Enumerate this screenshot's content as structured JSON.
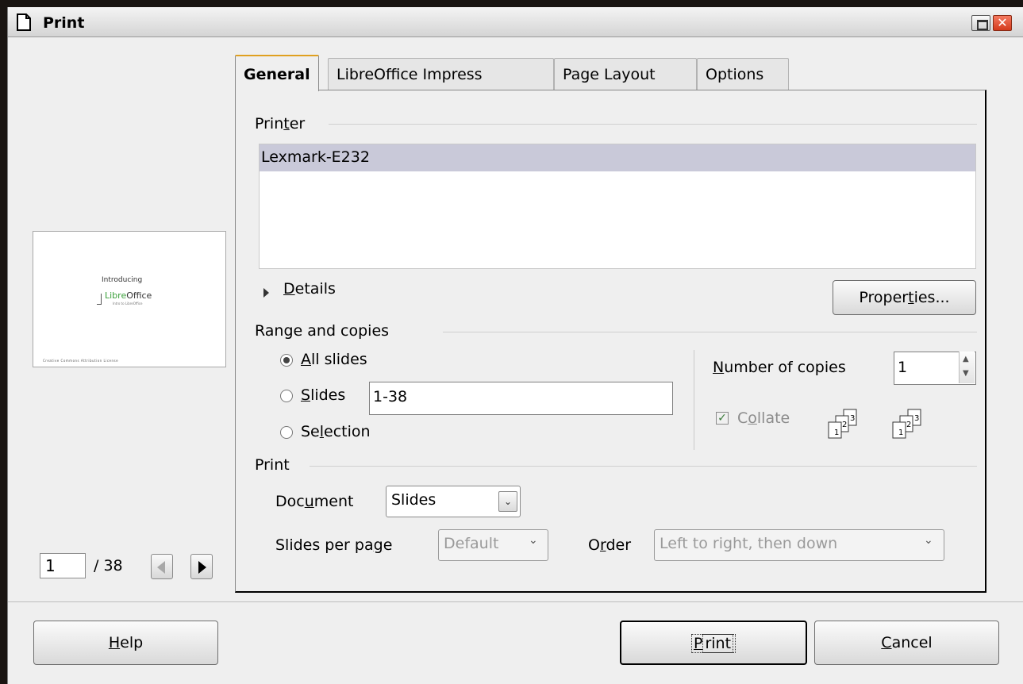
{
  "window": {
    "title": "Print",
    "close_glyph": "✕"
  },
  "preview": {
    "intro": "Introducing",
    "logo_plain": "Libre",
    "logo_rest": "Office",
    "subtitle": "Intro to LibreOffice",
    "footer": "Creative Commons Attribution License"
  },
  "pager": {
    "current": "1",
    "total": "/ 38"
  },
  "tabs": [
    {
      "label": "General"
    },
    {
      "label": "LibreOffice Impress"
    },
    {
      "label": "Page Layout"
    },
    {
      "label": "Options"
    }
  ],
  "printer": {
    "section_pre": "Prin",
    "section_mn": "t",
    "section_post": "er",
    "selected": "Lexmark-E232",
    "details_mn": "D",
    "details_rest": "etails",
    "properties_pre": "Proper",
    "properties_mn": "t",
    "properties_post": "ies..."
  },
  "range": {
    "section": "Range and copies",
    "all_mn": "A",
    "all_rest": "ll slides",
    "slides_mn": "S",
    "slides_rest": "lides",
    "slides_value": "1-38",
    "selection_pre": "Se",
    "selection_mn": "l",
    "selection_post": "ection",
    "copies_mn": "N",
    "copies_rest": "umber of copies",
    "copies_value": "1",
    "collate_pre": "C",
    "collate_mn": "o",
    "collate_post": "llate",
    "checkmark": "✓"
  },
  "print_section": {
    "section": "Print",
    "document_pre": "Doc",
    "document_mn": "u",
    "document_post": "ment",
    "document_value": "Slides",
    "spp_pre": "Slides per pa",
    "spp_mn": "g",
    "spp_post": "e",
    "spp_value": "Default",
    "order_pre": "O",
    "order_mn": "r",
    "order_post": "der",
    "order_value": "Left to right, then down",
    "chevron": "⌄"
  },
  "footer": {
    "help_mn": "H",
    "help_rest": "elp",
    "print_mn": "P",
    "print_rest": "rint",
    "cancel_mn": "C",
    "cancel_rest": "ancel"
  },
  "icons": [
    "document-icon",
    "maximize-icon",
    "close-icon",
    "prev-page-icon",
    "next-page-icon",
    "expander-icon",
    "collate-icon",
    "dropdown-icon"
  ]
}
